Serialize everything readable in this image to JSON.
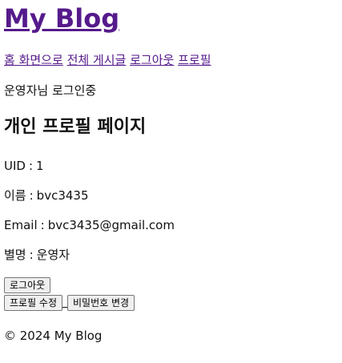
{
  "site": {
    "title": "My Blog"
  },
  "nav": {
    "items": [
      {
        "label": "홈 화면으로"
      },
      {
        "label": "전체 게시글"
      },
      {
        "label": "로그아웃"
      },
      {
        "label": "프로필"
      }
    ]
  },
  "session": {
    "status": "운영자님 로그인중"
  },
  "profile": {
    "heading": "개인 프로필 페이지",
    "uid_label": "UID",
    "uid_value": "1",
    "name_label": "이름",
    "name_value": "bvc3435",
    "email_label": "Email",
    "email_value": "bvc3435@gmail.com",
    "nick_label": "별명",
    "nick_value": "운영자",
    "separator": ":"
  },
  "buttons": {
    "logout": "로그아웃",
    "edit_profile": "프로필 수정",
    "change_password": "비밀번호 변경"
  },
  "footer": {
    "text": "© 2024 My Blog"
  },
  "colors": {
    "link_visited": "#551a8b"
  }
}
